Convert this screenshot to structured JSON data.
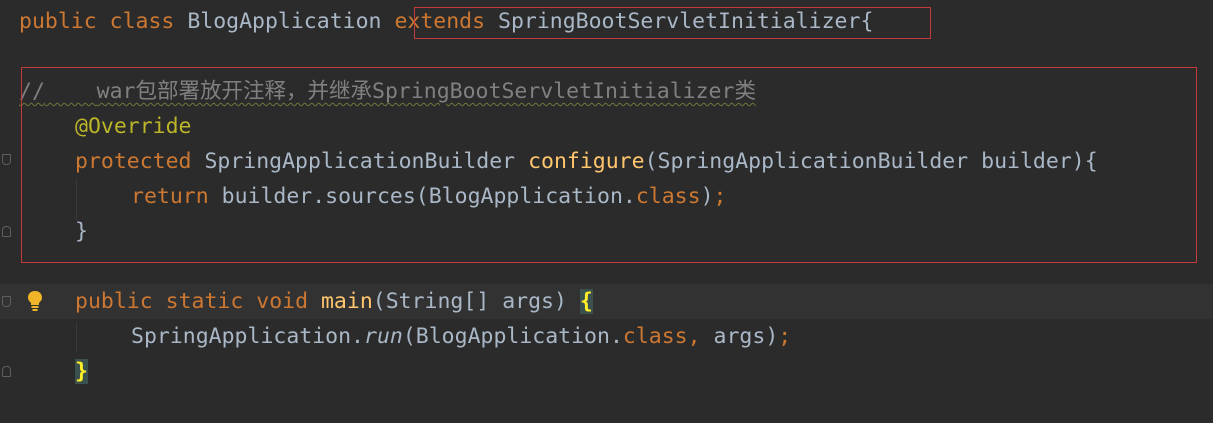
{
  "line1": {
    "public": "public",
    "class": "class",
    "classname": "BlogApplication",
    "extends": "extends",
    "superclass": "SpringBootServletInitializer",
    "brace": "{"
  },
  "comment": {
    "slashes": "//",
    "text": "war包部署放开注释，并继承SpringBootServletInitializer类"
  },
  "annotation": "@Override",
  "configure_line": {
    "protected": "protected",
    "return_type": "SpringApplicationBuilder",
    "method": "configure",
    "paren_open": "(",
    "param_type": "SpringApplicationBuilder",
    "param": "builder",
    "rest": "){"
  },
  "return_line": {
    "return": "return",
    "call": "builder.sources(BlogApplication.",
    "class_kw": "class",
    "end_paren": ")",
    "semicolon": ";"
  },
  "close_brace_1": "}",
  "main_line": {
    "public": "public",
    "static": "static",
    "void": "void",
    "method": "main",
    "params": "(String[] args)",
    "brace": "{"
  },
  "run_line": {
    "prefix": "SpringApplication.",
    "run": "run",
    "args_start": "(BlogApplication.",
    "class_kw": "class",
    "comma": ",",
    "args_end": "args)",
    "semicolon": ";"
  },
  "close_brace_2": "}",
  "icons": {
    "gutter_bulb": "lightbulb-icon",
    "fold_marker": "fold-marker-icon"
  },
  "colors": {
    "background": "#2b2b2b",
    "keyword": "#cc7832",
    "method": "#ffc66d",
    "annotation": "#bbb529",
    "comment": "#808080",
    "text": "#a9b7c6",
    "highlight_box": "#c33a3a"
  }
}
